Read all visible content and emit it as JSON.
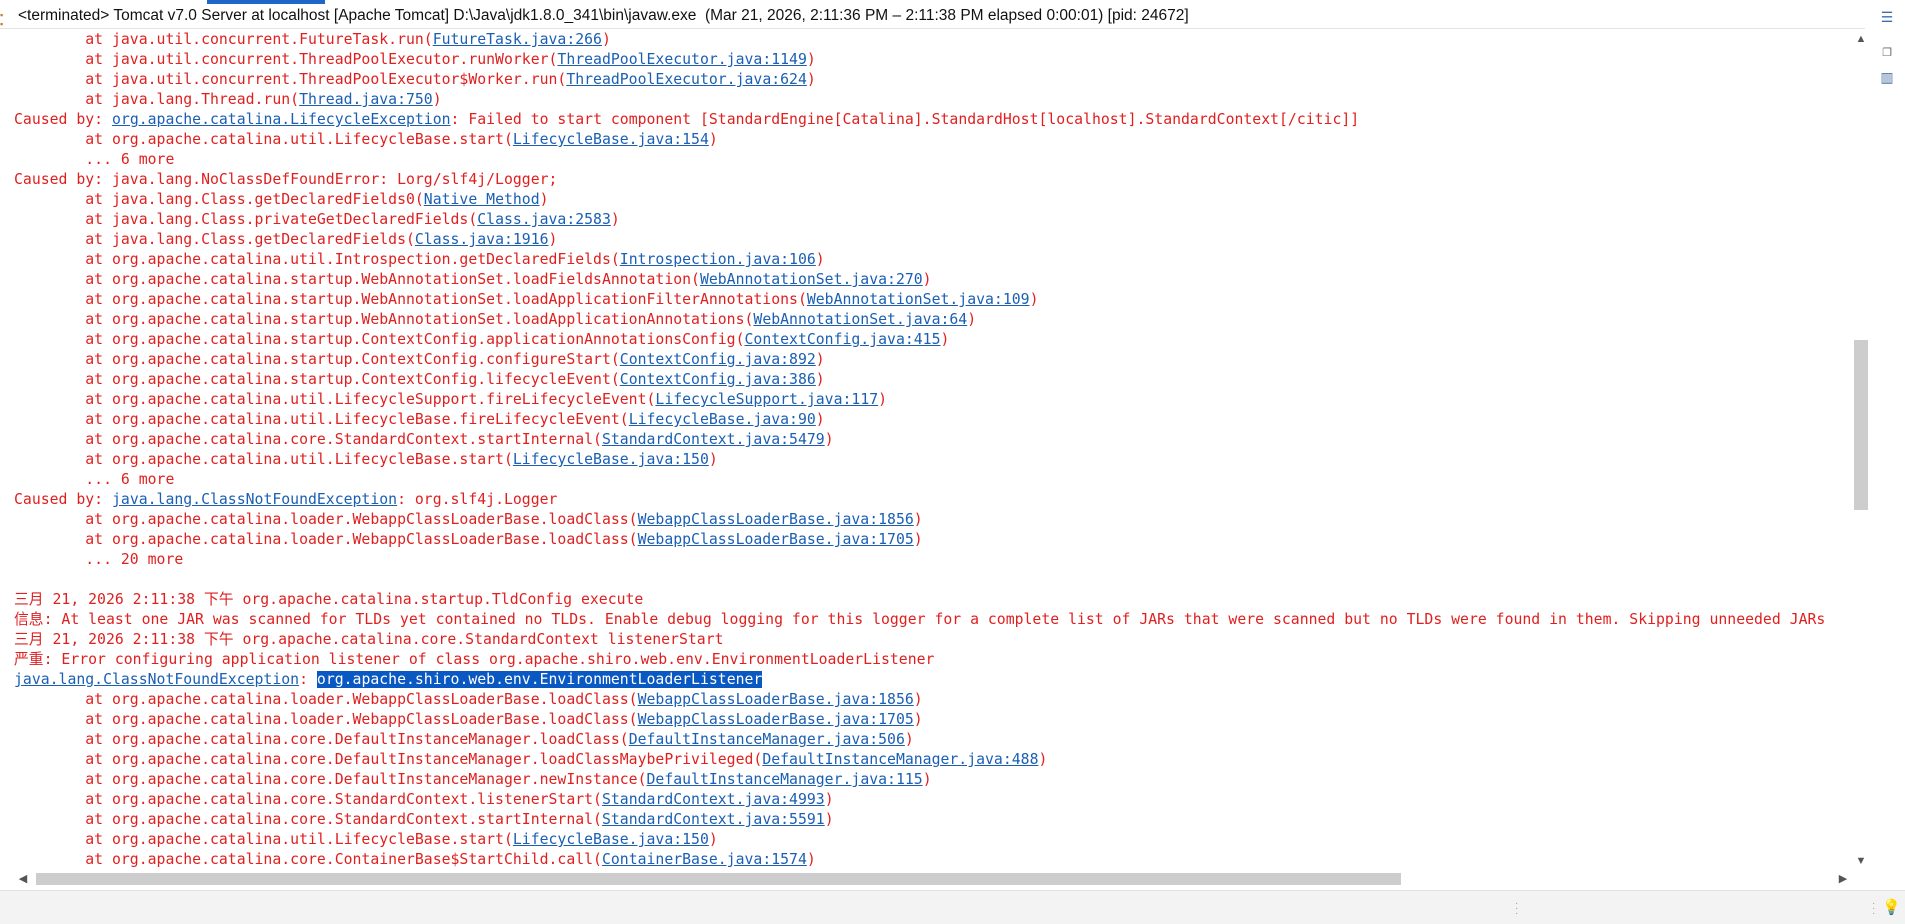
{
  "title_bar": {
    "process_label": "<terminated> Tomcat v7.0 Server at localhost [Apache Tomcat] D:\\Java\\jdk1.8.0_341\\bin\\javaw.exe  (Mar 21, 2026, 2:11:36 PM – 2:11:38 PM elapsed 0:00:01) [pid: 24672]"
  },
  "colors": {
    "error_text": "#e01f1f",
    "link": "#1a5fb4",
    "selection_bg": "#0a58c2"
  },
  "console_lines": [
    [
      {
        "t": "        at java.util.concurrent.FutureTask.run("
      },
      {
        "t": "FutureTask.java:266",
        "link": true
      },
      {
        "t": ")"
      }
    ],
    [
      {
        "t": "        at java.util.concurrent.ThreadPoolExecutor.runWorker("
      },
      {
        "t": "ThreadPoolExecutor.java:1149",
        "link": true
      },
      {
        "t": ")"
      }
    ],
    [
      {
        "t": "        at java.util.concurrent.ThreadPoolExecutor$Worker.run("
      },
      {
        "t": "ThreadPoolExecutor.java:624",
        "link": true
      },
      {
        "t": ")"
      }
    ],
    [
      {
        "t": "        at java.lang.Thread.run("
      },
      {
        "t": "Thread.java:750",
        "link": true
      },
      {
        "t": ")"
      }
    ],
    [
      {
        "t": "Caused by: "
      },
      {
        "t": "org.apache.catalina.LifecycleException",
        "link": true
      },
      {
        "t": ": Failed to start component [StandardEngine[Catalina].StandardHost[localhost].StandardContext[/citic]]"
      }
    ],
    [
      {
        "t": "        at org.apache.catalina.util.LifecycleBase.start("
      },
      {
        "t": "LifecycleBase.java:154",
        "link": true
      },
      {
        "t": ")"
      }
    ],
    [
      {
        "t": "        ... 6 more"
      }
    ],
    [
      {
        "t": "Caused by: java.lang.NoClassDefFoundError: Lorg/slf4j/Logger;"
      }
    ],
    [
      {
        "t": "        at java.lang.Class.getDeclaredFields0("
      },
      {
        "t": "Native Method",
        "link": true
      },
      {
        "t": ")"
      }
    ],
    [
      {
        "t": "        at java.lang.Class.privateGetDeclaredFields("
      },
      {
        "t": "Class.java:2583",
        "link": true
      },
      {
        "t": ")"
      }
    ],
    [
      {
        "t": "        at java.lang.Class.getDeclaredFields("
      },
      {
        "t": "Class.java:1916",
        "link": true
      },
      {
        "t": ")"
      }
    ],
    [
      {
        "t": "        at org.apache.catalina.util.Introspection.getDeclaredFields("
      },
      {
        "t": "Introspection.java:106",
        "link": true
      },
      {
        "t": ")"
      }
    ],
    [
      {
        "t": "        at org.apache.catalina.startup.WebAnnotationSet.loadFieldsAnnotation("
      },
      {
        "t": "WebAnnotationSet.java:270",
        "link": true
      },
      {
        "t": ")"
      }
    ],
    [
      {
        "t": "        at org.apache.catalina.startup.WebAnnotationSet.loadApplicationFilterAnnotations("
      },
      {
        "t": "WebAnnotationSet.java:109",
        "link": true
      },
      {
        "t": ")"
      }
    ],
    [
      {
        "t": "        at org.apache.catalina.startup.WebAnnotationSet.loadApplicationAnnotations("
      },
      {
        "t": "WebAnnotationSet.java:64",
        "link": true
      },
      {
        "t": ")"
      }
    ],
    [
      {
        "t": "        at org.apache.catalina.startup.ContextConfig.applicationAnnotationsConfig("
      },
      {
        "t": "ContextConfig.java:415",
        "link": true
      },
      {
        "t": ")"
      }
    ],
    [
      {
        "t": "        at org.apache.catalina.startup.ContextConfig.configureStart("
      },
      {
        "t": "ContextConfig.java:892",
        "link": true
      },
      {
        "t": ")"
      }
    ],
    [
      {
        "t": "        at org.apache.catalina.startup.ContextConfig.lifecycleEvent("
      },
      {
        "t": "ContextConfig.java:386",
        "link": true
      },
      {
        "t": ")"
      }
    ],
    [
      {
        "t": "        at org.apache.catalina.util.LifecycleSupport.fireLifecycleEvent("
      },
      {
        "t": "LifecycleSupport.java:117",
        "link": true
      },
      {
        "t": ")"
      }
    ],
    [
      {
        "t": "        at org.apache.catalina.util.LifecycleBase.fireLifecycleEvent("
      },
      {
        "t": "LifecycleBase.java:90",
        "link": true
      },
      {
        "t": ")"
      }
    ],
    [
      {
        "t": "        at org.apache.catalina.core.StandardContext.startInternal("
      },
      {
        "t": "StandardContext.java:5479",
        "link": true
      },
      {
        "t": ")"
      }
    ],
    [
      {
        "t": "        at org.apache.catalina.util.LifecycleBase.start("
      },
      {
        "t": "LifecycleBase.java:150",
        "link": true
      },
      {
        "t": ")"
      }
    ],
    [
      {
        "t": "        ... 6 more"
      }
    ],
    [
      {
        "t": "Caused by: "
      },
      {
        "t": "java.lang.ClassNotFoundException",
        "link": true
      },
      {
        "t": ": org.slf4j.Logger"
      }
    ],
    [
      {
        "t": "        at org.apache.catalina.loader.WebappClassLoaderBase.loadClass("
      },
      {
        "t": "WebappClassLoaderBase.java:1856",
        "link": true
      },
      {
        "t": ")"
      }
    ],
    [
      {
        "t": "        at org.apache.catalina.loader.WebappClassLoaderBase.loadClass("
      },
      {
        "t": "WebappClassLoaderBase.java:1705",
        "link": true
      },
      {
        "t": ")"
      }
    ],
    [
      {
        "t": "        ... 20 more"
      }
    ],
    [
      {
        "t": ""
      }
    ],
    [
      {
        "t": "三月 21, 2026 2:11:38 下午 org.apache.catalina.startup.TldConfig execute"
      }
    ],
    [
      {
        "t": "信息: At least one JAR was scanned for TLDs yet contained no TLDs. Enable debug logging for this logger for a complete list of JARs that were scanned but no TLDs were found in them. Skipping unneeded JARs"
      }
    ],
    [
      {
        "t": "三月 21, 2026 2:11:38 下午 org.apache.catalina.core.StandardContext listenerStart"
      }
    ],
    [
      {
        "t": "严重: Error configuring application listener of class org.apache.shiro.web.env.EnvironmentLoaderListener"
      }
    ],
    [
      {
        "t": "java.lang.ClassNotFoundException",
        "link": true
      },
      {
        "t": ": "
      },
      {
        "t": "org.apache.shiro.web.env.EnvironmentLoaderListener",
        "sel": true
      }
    ],
    [
      {
        "t": "        at org.apache.catalina.loader.WebappClassLoaderBase.loadClass("
      },
      {
        "t": "WebappClassLoaderBase.java:1856",
        "link": true
      },
      {
        "t": ")"
      }
    ],
    [
      {
        "t": "        at org.apache.catalina.loader.WebappClassLoaderBase.loadClass("
      },
      {
        "t": "WebappClassLoaderBase.java:1705",
        "link": true
      },
      {
        "t": ")"
      }
    ],
    [
      {
        "t": "        at org.apache.catalina.core.DefaultInstanceManager.loadClass("
      },
      {
        "t": "DefaultInstanceManager.java:506",
        "link": true
      },
      {
        "t": ")"
      }
    ],
    [
      {
        "t": "        at org.apache.catalina.core.DefaultInstanceManager.loadClassMaybePrivileged("
      },
      {
        "t": "DefaultInstanceManager.java:488",
        "link": true
      },
      {
        "t": ")"
      }
    ],
    [
      {
        "t": "        at org.apache.catalina.core.DefaultInstanceManager.newInstance("
      },
      {
        "t": "DefaultInstanceManager.java:115",
        "link": true
      },
      {
        "t": ")"
      }
    ],
    [
      {
        "t": "        at org.apache.catalina.core.StandardContext.listenerStart("
      },
      {
        "t": "StandardContext.java:4993",
        "link": true
      },
      {
        "t": ")"
      }
    ],
    [
      {
        "t": "        at org.apache.catalina.core.StandardContext.startInternal("
      },
      {
        "t": "StandardContext.java:5591",
        "link": true
      },
      {
        "t": ")"
      }
    ],
    [
      {
        "t": "        at org.apache.catalina.util.LifecycleBase.start("
      },
      {
        "t": "LifecycleBase.java:150",
        "link": true
      },
      {
        "t": ")"
      }
    ],
    [
      {
        "t": "        at org.apache.catalina.core.ContainerBase$StartChild.call("
      },
      {
        "t": "ContainerBase.java:1574",
        "link": true
      },
      {
        "t": ")"
      }
    ]
  ]
}
